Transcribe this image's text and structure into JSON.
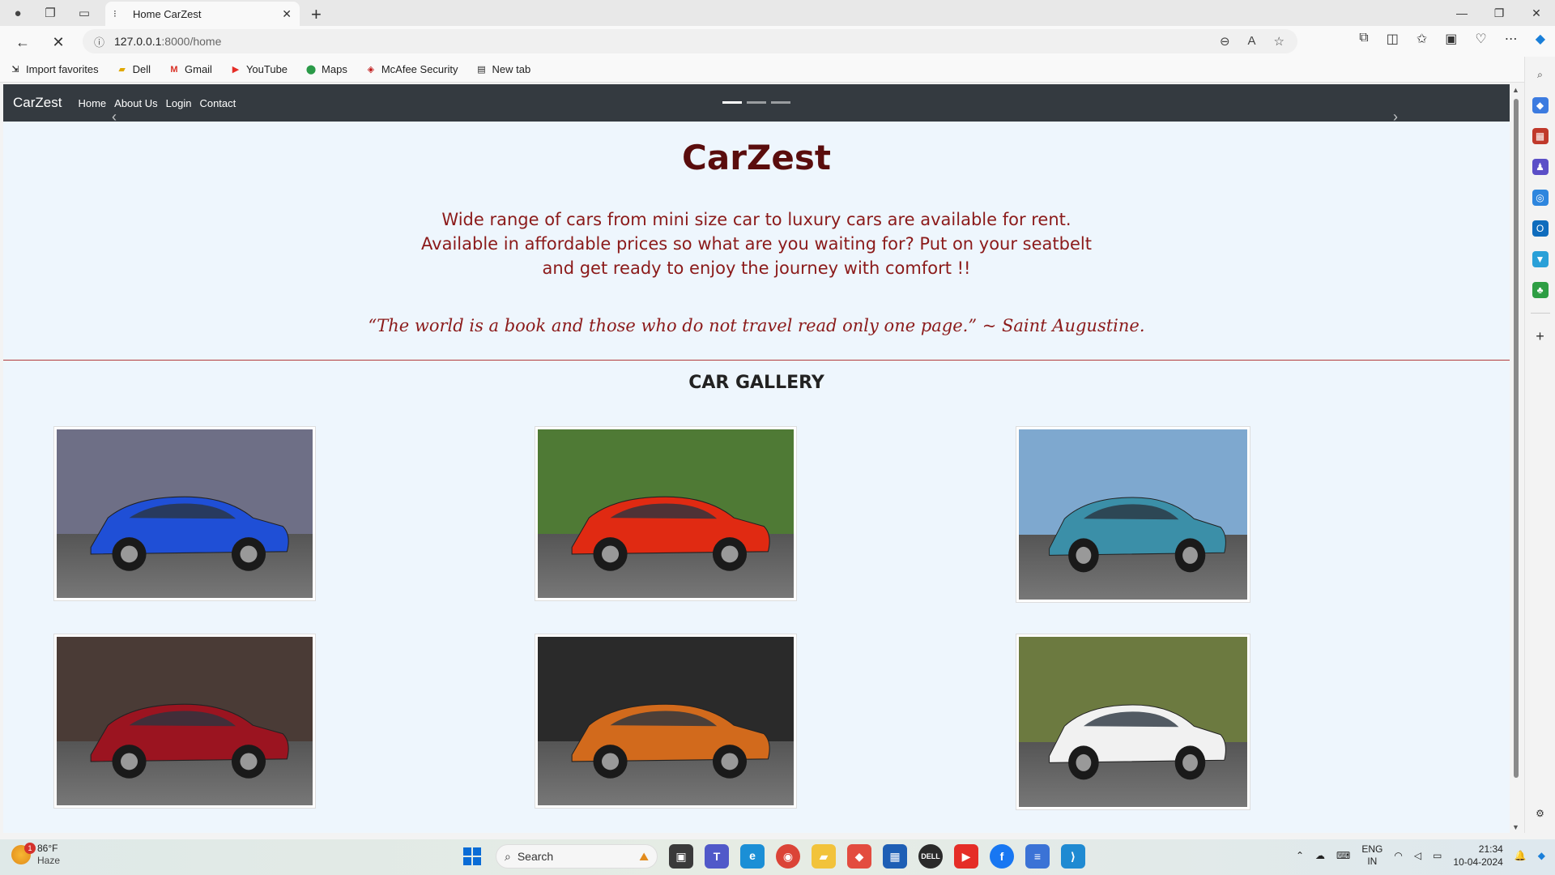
{
  "browser": {
    "tab_title": "Home CarZest",
    "url_host": "127.0.0.1",
    "url_rest": ":8000/home",
    "favorites": [
      {
        "label": "Import favorites",
        "icon": "import-icon"
      },
      {
        "label": "Dell",
        "icon": "folder-icon"
      },
      {
        "label": "Gmail",
        "icon": "gmail-icon"
      },
      {
        "label": "YouTube",
        "icon": "youtube-icon"
      },
      {
        "label": "Maps",
        "icon": "maps-icon"
      },
      {
        "label": "McAfee Security",
        "icon": "mcafee-icon"
      },
      {
        "label": "New tab",
        "icon": "newtab-icon"
      }
    ]
  },
  "site": {
    "brand": "CarZest",
    "nav": [
      "Home",
      "About Us",
      "Login",
      "Contact"
    ],
    "heading": "CarZest",
    "intro": "Wide range of cars from mini size car to luxury cars are available for rent. Available in affordable prices so what are you waiting for? Put on your seatbelt and get ready to enjoy the journey with comfort !!",
    "quote": "“The world is a book and those who do not travel read only one page.” ~ Saint Augustine.",
    "gallery_title": "CAR GALLERY",
    "cars": [
      {
        "color": "#1f4fd6",
        "bg": "#6e6f86"
      },
      {
        "color": "#e02a12",
        "bg": "#4f7a35"
      },
      {
        "color": "#3b8fa8",
        "bg": "#7ea8cf"
      },
      {
        "color": "#9b1420",
        "bg": "#4a3b36"
      },
      {
        "color": "#d26a1c",
        "bg": "#2a2a2a"
      },
      {
        "color": "#f1f1f1",
        "bg": "#6c7a40"
      }
    ]
  },
  "taskbar": {
    "temp": "86°F",
    "weather": "Haze",
    "notif_count": "1",
    "search_placeholder": "Search",
    "lang1": "ENG",
    "lang2": "IN",
    "time": "21:34",
    "date": "10-04-2024"
  }
}
